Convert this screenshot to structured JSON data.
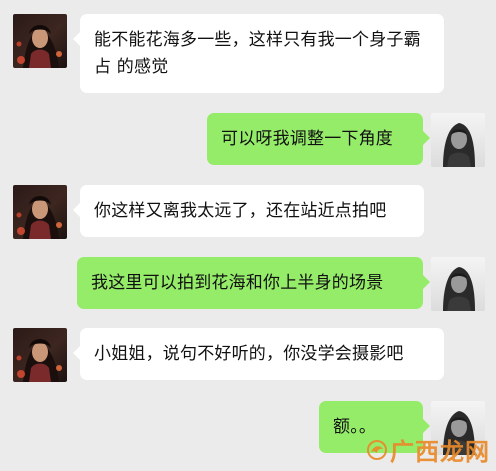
{
  "chat": {
    "messages": [
      {
        "side": "left",
        "text": "能不能花海多一些，这样只有我一个身子霸占 的感觉",
        "avatar": "girl-avatar"
      },
      {
        "side": "right",
        "text": "可以呀我调整一下角度",
        "avatar": "photographer-avatar"
      },
      {
        "side": "left",
        "text": "你这样又离我太远了，还在站近点拍吧",
        "avatar": "girl-avatar"
      },
      {
        "side": "right",
        "text": "我这里可以拍到花海和你上半身的场景",
        "avatar": "photographer-avatar"
      },
      {
        "side": "left",
        "text": "小姐姐，说句不好听的，你没学会摄影吧",
        "avatar": "girl-avatar"
      },
      {
        "side": "right",
        "text": "额。。",
        "avatar": "photographer-avatar"
      }
    ]
  },
  "watermark": {
    "text": "广西龙网",
    "color": "#e98a2a"
  },
  "colors": {
    "background": "#ebebeb",
    "incoming_bubble": "#ffffff",
    "outgoing_bubble": "#95ec69"
  }
}
